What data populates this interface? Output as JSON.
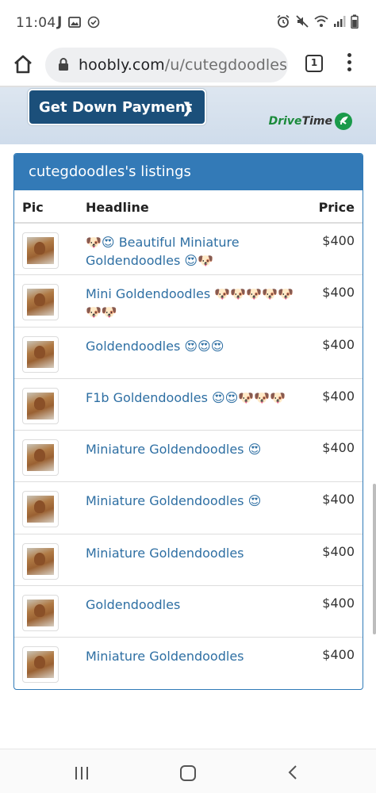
{
  "status_bar": {
    "time": "11:04",
    "left_letter": "J",
    "icons_left": [
      "image-icon",
      "check-circle-icon"
    ],
    "icons_right": [
      "alarm-icon",
      "mute-icon",
      "wifi-icon",
      "signal-icon",
      "battery-icon"
    ]
  },
  "browser": {
    "url_domain": "hoobly.com",
    "url_path": "/u/cutegdoodles",
    "tab_count": "1"
  },
  "ad": {
    "cta_label": "Get Down Payment",
    "brand_part1": "Drive",
    "brand_part2": "Time"
  },
  "listings": {
    "title": "cutegdoodles's listings",
    "columns": {
      "pic": "Pic",
      "headline": "Headline",
      "price": "Price"
    },
    "rows": [
      {
        "headline": "🐶😍 Beautiful Miniature Goldendoodles 😍🐶",
        "price": "$400"
      },
      {
        "headline": "Mini Goldendoodles 🐶🐶🐶🐶🐶🐶🐶",
        "price": "$400"
      },
      {
        "headline": "Goldendoodles 😍😍😍",
        "price": "$400"
      },
      {
        "headline": "F1b Goldendoodles 😍😍🐶🐶🐶",
        "price": "$400"
      },
      {
        "headline": "Miniature Goldendoodles 😍",
        "price": "$400"
      },
      {
        "headline": "Miniature Goldendoodles 😍",
        "price": "$400"
      },
      {
        "headline": "Miniature Goldendoodles",
        "price": "$400"
      },
      {
        "headline": "Goldendoodles",
        "price": "$400"
      },
      {
        "headline": "Miniature Goldendoodles",
        "price": "$400"
      }
    ]
  },
  "colors": {
    "panel_header": "#337ab7",
    "link": "#2e6fa3",
    "ad_button": "#1b4f7a",
    "brand_green": "#1a8a3a"
  }
}
